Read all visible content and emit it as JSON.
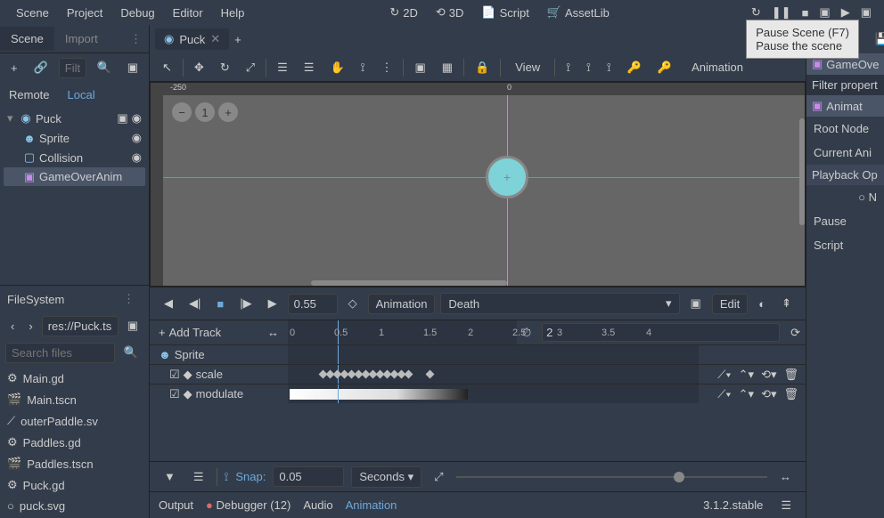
{
  "menu": {
    "scene": "Scene",
    "project": "Project",
    "debug": "Debug",
    "editor": "Editor",
    "help": "Help"
  },
  "modes": {
    "two_d": "2D",
    "three_d": "3D",
    "script": "Script",
    "assetlib": "AssetLib"
  },
  "tooltip": {
    "line1": "Pause Scene (F7)",
    "line2": "Pause the scene"
  },
  "left_tabs": {
    "scene": "Scene",
    "import": "Import"
  },
  "filter_placeholder": "Filter",
  "subtabs": {
    "remote": "Remote",
    "local": "Local"
  },
  "tree": {
    "root": "Puck",
    "sprite": "Sprite",
    "collision": "Collision",
    "gameover": "GameOverAnim"
  },
  "fs": {
    "title": "FileSystem",
    "path": "res://Puck.ts",
    "search_placeholder": "Search files",
    "items": [
      "Main.gd",
      "Main.tscn",
      "outerPaddle.sv",
      "Paddles.gd",
      "Paddles.tscn",
      "Puck.gd",
      "puck.svg"
    ]
  },
  "scene_tab": "Puck",
  "ruler": {
    "tick": "-250",
    "zero": "0"
  },
  "view_label": "View",
  "anim_label_side": "Animation",
  "anim": {
    "time": "0.55",
    "anim_btn": "Animation",
    "name": "Death",
    "edit": "Edit",
    "add_track": "Add Track",
    "length": "2",
    "ticks": [
      "0",
      "0.5",
      "1",
      "1.5",
      "2",
      "2.5",
      "3",
      "3.5",
      "4"
    ],
    "sprite_row": "Sprite",
    "scale": "scale",
    "modulate": "modulate",
    "snap_label": "Snap:",
    "snap_value": "0.05",
    "seconds": "Seconds"
  },
  "status": {
    "output": "Output",
    "debugger": "Debugger (12)",
    "audio": "Audio",
    "animation": "Animation",
    "version": "3.1.2.stable"
  },
  "inspector": {
    "gameover": "GameOve",
    "filter": "Filter propert",
    "anima": "Animat",
    "root_node": "Root Node",
    "current_ani": "Current Ani",
    "playback": "Playback Op",
    "n": "N",
    "pause": "Pause",
    "script": "Script"
  }
}
